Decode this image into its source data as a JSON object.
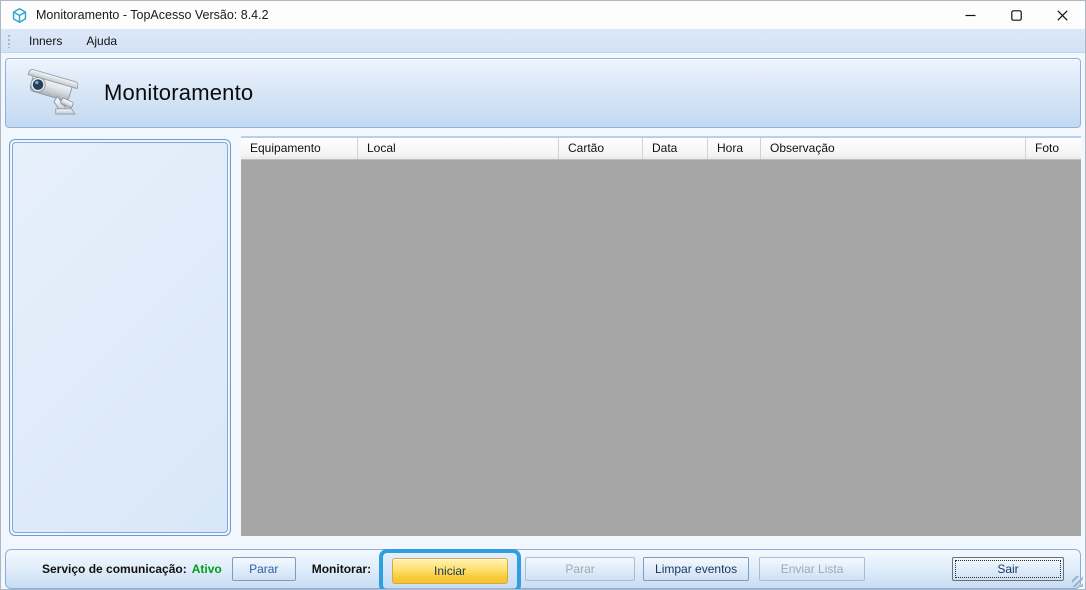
{
  "window": {
    "title": "Monitoramento - TopAcesso Versão: 8.4.2"
  },
  "menu": {
    "items": [
      {
        "label": "Inners"
      },
      {
        "label": "Ajuda"
      }
    ]
  },
  "header": {
    "title": "Monitoramento"
  },
  "table": {
    "columns": [
      {
        "label": "Equipamento"
      },
      {
        "label": "Local"
      },
      {
        "label": "Cartão"
      },
      {
        "label": "Data"
      },
      {
        "label": "Hora"
      },
      {
        "label": "Observação"
      },
      {
        "label": "Foto"
      }
    ],
    "rows": []
  },
  "statusbar": {
    "service_label": "Serviço de comunicação:",
    "service_status": "Ativo",
    "service_status_color": "#00A113",
    "parar_service_label": "Parar",
    "monitor_label": "Monitorar:",
    "iniciar_label": "Iniciar",
    "parar_monitor_label": "Parar",
    "limpar_label": "Limpar eventos",
    "enviar_label": "Enviar Lista",
    "sair_label": "Sair"
  },
  "colors": {
    "highlight_box": "#2F9EE3",
    "iniciar_button": "#F8CB3A",
    "table_body_gray": "#A6A6A6",
    "app_icon_teal": "#2BA8CB"
  }
}
